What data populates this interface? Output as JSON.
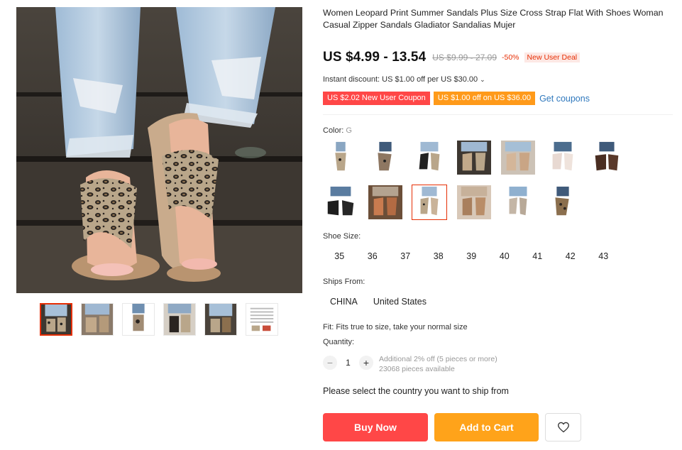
{
  "product": {
    "title": "Women Leopard Print Summer Sandals Plus Size Cross Strap Flat With Shoes Woman Casual Zipper Sandals Gladiator Sandalias Mujer"
  },
  "price": {
    "current": "US $4.99 - 13.54",
    "original": "US $9.99 - 27.09",
    "discount": "-50%",
    "deal_badge": "New User Deal"
  },
  "instant_discount": {
    "text": "Instant discount: US $1.00 off per US $30.00",
    "chevron_icon": "chevron-down-icon"
  },
  "coupons": {
    "items": [
      {
        "label": "US $2.02 New User Coupon",
        "color": "#ff4747"
      },
      {
        "label": "US $1.00 off on US $36.00",
        "color": "#ff9a1a"
      }
    ],
    "get_label": "Get coupons"
  },
  "color": {
    "label": "Color:",
    "selected_value": "G",
    "swatch_count": 13,
    "selected_index": 9
  },
  "size": {
    "label": "Shoe Size:",
    "options": [
      "35",
      "36",
      "37",
      "38",
      "39",
      "40",
      "41",
      "42",
      "43"
    ]
  },
  "ships_from": {
    "label": "Ships From:",
    "options": [
      "CHINA",
      "United States"
    ]
  },
  "fit": "Fit: Fits true to size, take your normal size",
  "quantity": {
    "label": "Quantity:",
    "value": "1",
    "minus_icon": "minus-icon",
    "plus_icon": "plus-icon",
    "note": "Additional 2% off (5 pieces or more)",
    "available": "23068 pieces available"
  },
  "country_prompt": "Please select the country you want to ship from",
  "actions": {
    "buy_now": "Buy Now",
    "add_to_cart": "Add to Cart",
    "wishlist_icon": "heart-icon"
  },
  "gallery": {
    "thumbnail_count": 6,
    "active_index": 0
  },
  "colors": {
    "accent": "#ff4747",
    "cart": "#ffa31a",
    "link": "#2f78bd",
    "price_red": "#e62e04"
  }
}
